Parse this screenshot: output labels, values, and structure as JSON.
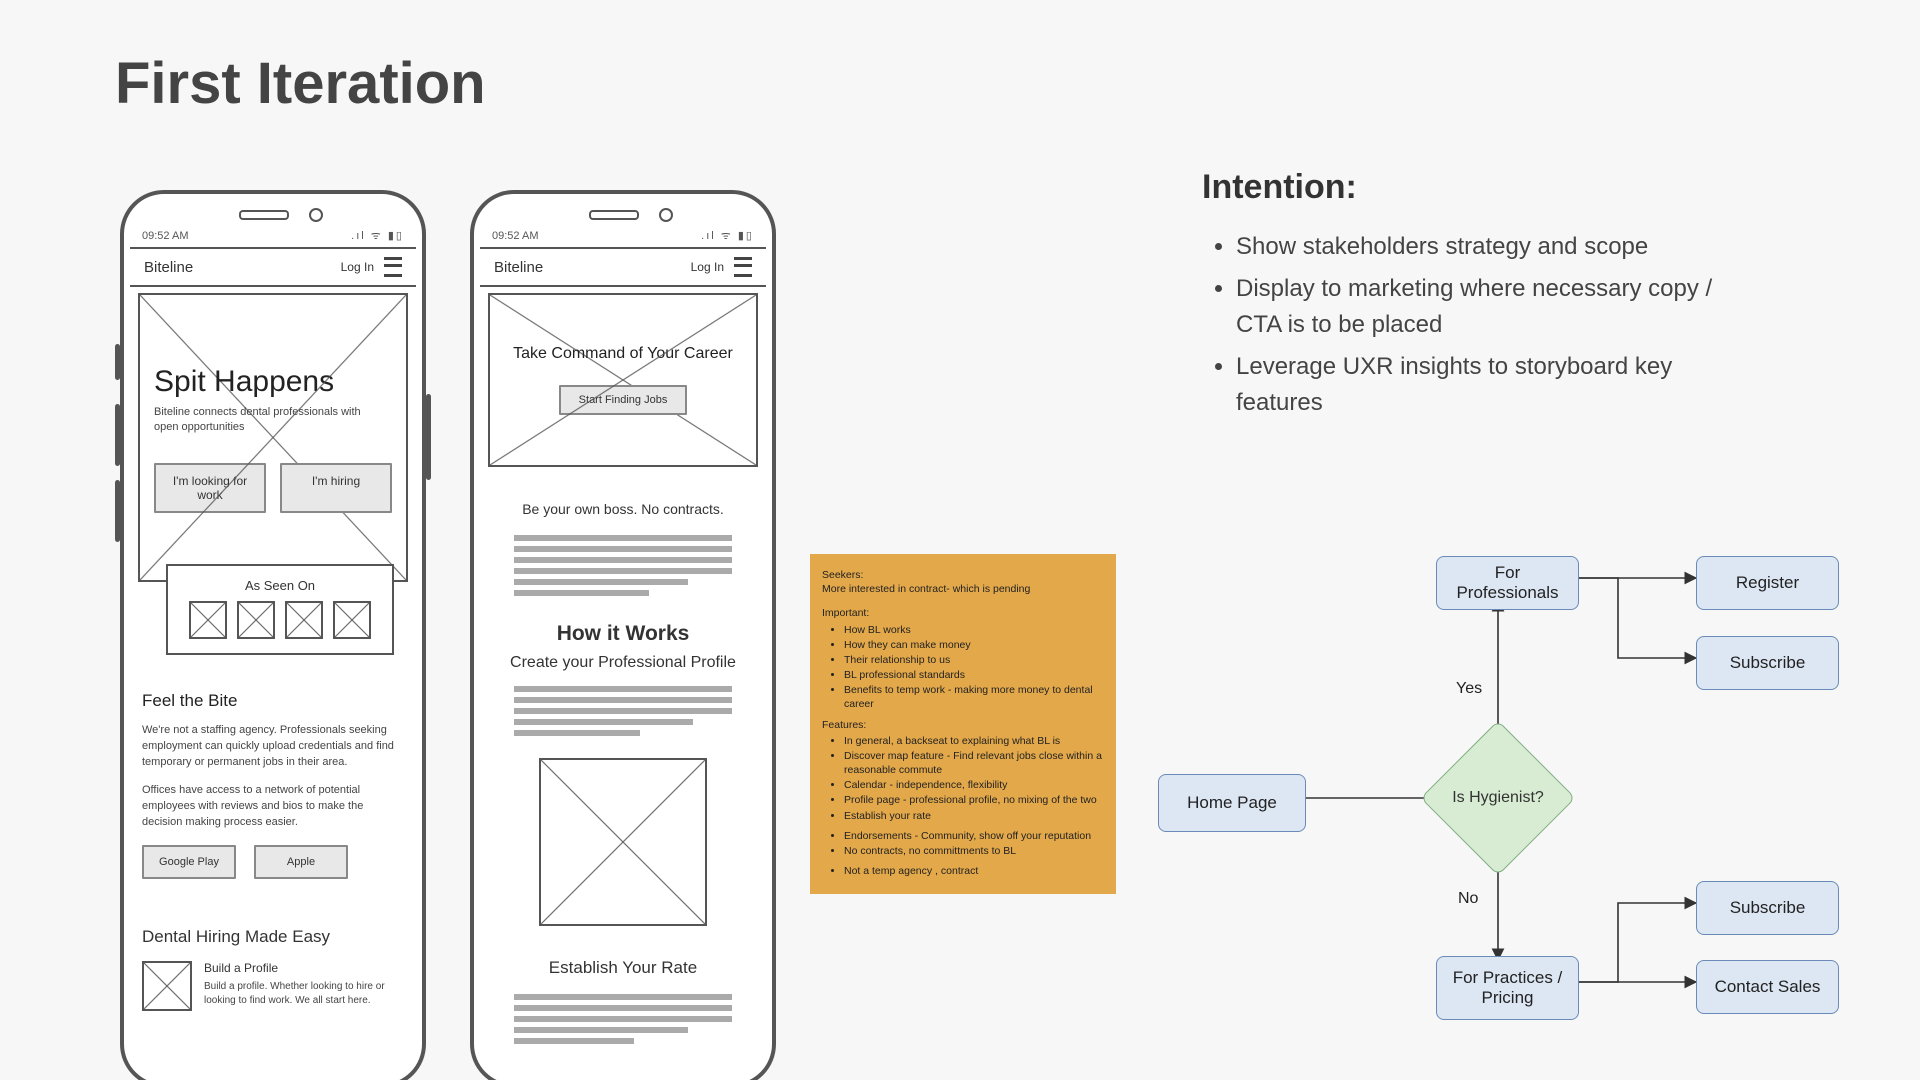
{
  "title": "First Iteration",
  "phone_common": {
    "time": "09:52 AM",
    "status_icons": ".ıl ᯤ ▮▯",
    "brand": "Biteline",
    "login": "Log In"
  },
  "phone1": {
    "hero_h1": "Spit Happens",
    "hero_p": "Biteline connects dental professionals with open opportunities",
    "btn_seeker": "I'm looking for work",
    "btn_hiring": "I'm hiring",
    "asseen": "As Seen On",
    "feel_h": "Feel the Bite",
    "feel_p1": "We're not a staffing agency. Professionals seeking employment can quickly upload credentials and find temporary or permanent jobs in their area.",
    "feel_p2": "Offices have access to a network of potential employees with reviews and bios to make the decision making process easier.",
    "google": "Google Play",
    "apple": "Apple",
    "easy_h": "Dental Hiring Made Easy",
    "build_h": "Build a Profile",
    "build_p": "Build a profile. Whether looking to hire or looking to find work. We all start here."
  },
  "phone2": {
    "hero_h": "Take Command of Your Career",
    "hero_btn": "Start Finding Jobs",
    "sub1": "Be your own boss. No contracts.",
    "hiw": "How it Works",
    "cpp": "Create your Professional Profile",
    "eyr": "Establish Your Rate"
  },
  "note": {
    "seekers_h": "Seekers:",
    "seekers_l": "More interested in contract- which is pending",
    "imp_h": "Important:",
    "imp": [
      "How BL works",
      "How they can make money",
      "Their relationship to us",
      "BL professional standards",
      "Benefits to temp work - making more money to dental career"
    ],
    "feat_h": "Features:",
    "feat": [
      "In general, a backseat to explaining what BL is",
      "Discover map feature - Find relevant jobs close within a reasonable commute",
      "Calendar - independence, flexibility",
      "Profile page - professional profile, no mixing of the two",
      "Establish your rate"
    ],
    "feat2": [
      "Endorsements - Community, show off your reputation",
      "No contracts, no committments to BL"
    ],
    "feat3": [
      "Not a temp agency , contract"
    ]
  },
  "intent": {
    "h": "Intention:",
    "items": [
      "Show stakeholders strategy and scope",
      "Display to marketing where necessary copy / CTA is to be placed",
      "Leverage UXR insights to storyboard key features"
    ]
  },
  "flow": {
    "home": "Home Page",
    "decision": "Is Hygienist?",
    "yes": "Yes",
    "no": "No",
    "pros": "For Professionals",
    "register": "Register",
    "subscribe1": "Subscribe",
    "practices": "For Practices / Pricing",
    "subscribe2": "Subscribe",
    "contact": "Contact Sales"
  }
}
